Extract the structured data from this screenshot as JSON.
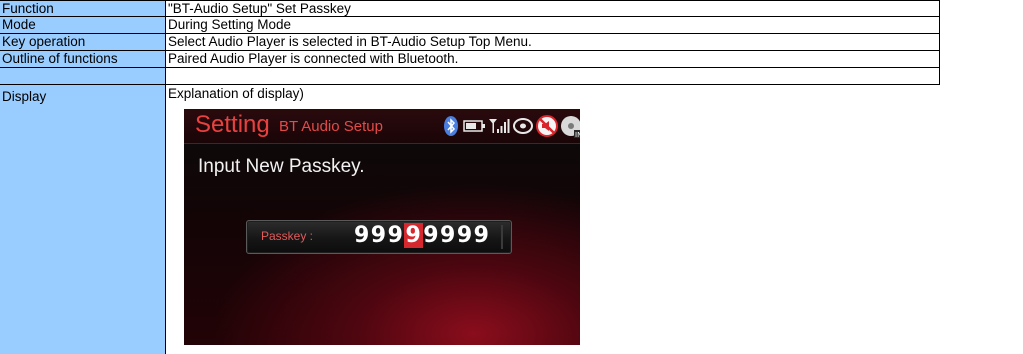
{
  "rows": [
    {
      "label": "Function",
      "value": "\"BT-Audio Setup\" Set Passkey"
    },
    {
      "label": "Mode",
      "value": "During Setting Mode"
    },
    {
      "label": "Key operation",
      "value": "Select Audio Player is selected in BT-Audio Setup Top Menu."
    },
    {
      "label": "Outline of functions",
      "value": "Paired Audio Player is connected with Bluetooth."
    }
  ],
  "display": {
    "label": "Display",
    "explanation": "Explanation of display)",
    "screen": {
      "title": "Setting",
      "subtitle": "BT Audio Setup",
      "status_icons": [
        "bluetooth-icon",
        "battery-icon",
        "signal-icon",
        "cd-icon",
        "mute-icon",
        "disc-in-icon"
      ],
      "prompt": "Input New Passkey.",
      "passkey_label": "Passkey :",
      "passkey_before": "999",
      "passkey_selected": "9",
      "passkey_after": "9999",
      "accent_color": "#e9413f",
      "highlight_color": "#d5282f"
    }
  }
}
